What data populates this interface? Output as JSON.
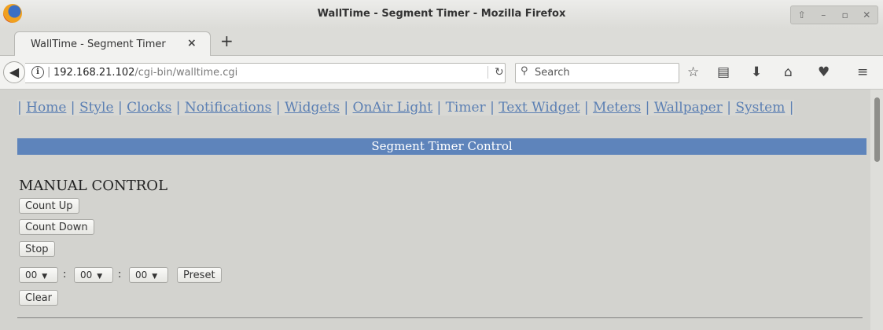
{
  "window": {
    "title": "WallTime - Segment Timer - Mozilla Firefox"
  },
  "tabs": [
    {
      "label": "WallTime - Segment Timer",
      "close": "×"
    }
  ],
  "newtab": "+",
  "urlbar": {
    "host": "192.168.21.102",
    "path": "/cgi-bin/walltime.cgi"
  },
  "search": {
    "placeholder": "Search"
  },
  "nav": {
    "links": [
      "Home",
      "Style",
      "Clocks",
      "Notifications",
      "Widgets",
      "OnAir Light",
      "Timer",
      "Text Widget",
      "Meters",
      "Wallpaper",
      "System"
    ],
    "current": "Timer"
  },
  "banner": "Segment Timer Control",
  "manual": {
    "heading": "MANUAL CONTROL",
    "count_up": "Count Up",
    "count_down": "Count Down",
    "stop": "Stop",
    "hours": "00",
    "minutes": "00",
    "seconds": "00",
    "colon": ":",
    "preset": "Preset",
    "clear": "Clear"
  },
  "colors": {
    "link": "#5b7fb3",
    "banner": "#5e84bb",
    "page_bg": "#d3d3cf"
  },
  "icons": [
    "firefox-logo",
    "back-arrow-icon",
    "info-icon",
    "reload-icon",
    "search-icon",
    "bookmark-star-icon",
    "reading-list-icon",
    "download-icon",
    "home-icon",
    "pocket-icon",
    "menu-icon"
  ]
}
